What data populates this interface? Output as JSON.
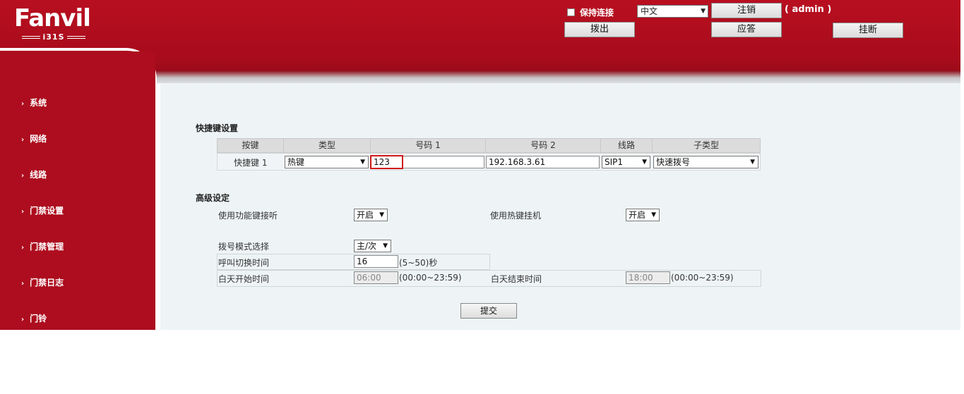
{
  "brand": {
    "logo_text": "Fanvil",
    "model": "i31S"
  },
  "header": {
    "keep_connected": "保持连接",
    "language": "中文",
    "logout_button": "注销",
    "user": "( admin )",
    "dial_button": "拨出",
    "answer_button": "应答",
    "hangup_button": "挂断"
  },
  "sidebar": {
    "items": [
      {
        "label": "系统"
      },
      {
        "label": "网络"
      },
      {
        "label": "线路"
      },
      {
        "label": "门禁设置"
      },
      {
        "label": "门禁管理"
      },
      {
        "label": "门禁日志"
      },
      {
        "label": "门铃"
      }
    ]
  },
  "hotkey": {
    "title": "快捷键设置",
    "columns": [
      "按键",
      "类型",
      "号码 1",
      "号码 2",
      "线路",
      "子类型"
    ],
    "row": {
      "key": "快捷键 1",
      "type": "热键",
      "number1": "123",
      "number2": "192.168.3.61",
      "line": "SIP1",
      "subtype": "快速拨号"
    }
  },
  "advanced": {
    "title": "高级设定",
    "use_func_key_answer_label": "使用功能键接听",
    "use_func_key_answer_value": "开启",
    "use_hotkey_hangup_label": "使用热键挂机",
    "use_hotkey_hangup_value": "开启",
    "dial_mode_label": "拨号模式选择",
    "dial_mode_value": "主/次",
    "call_switch_label": "呼叫切换时间",
    "call_switch_value": "16",
    "call_switch_hint": "(5~50)秒",
    "day_start_label": "白天开始时间",
    "day_start_value": "06:00",
    "day_start_hint": "(00:00~23:59)",
    "day_end_label": "白天结束时间",
    "day_end_value": "18:00",
    "day_end_hint": "(00:00~23:59)"
  },
  "submit_label": "提交"
}
